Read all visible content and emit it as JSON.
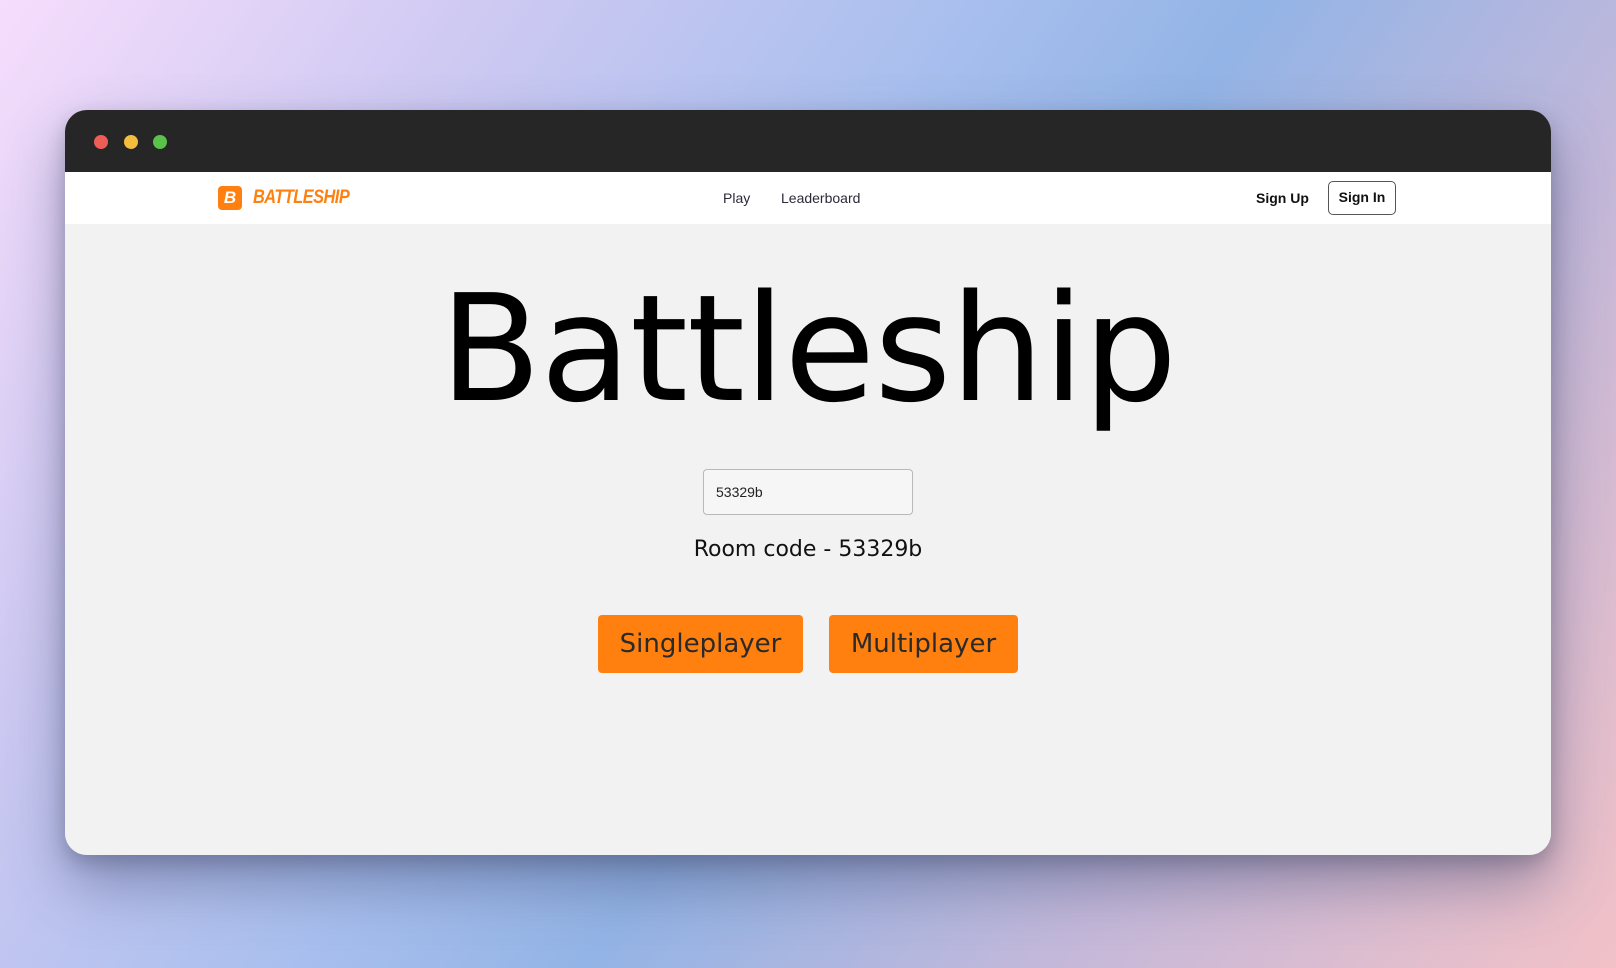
{
  "colors": {
    "accent": "#ff7f0f",
    "titlebar": "#262626",
    "content_background": "#f2f2f2"
  },
  "window": {
    "controls": [
      "close",
      "minimize",
      "maximize"
    ]
  },
  "navbar": {
    "brand_mark": "B",
    "brand_text": "BATTLESHIP",
    "links": [
      "Play",
      "Leaderboard"
    ],
    "sign_up_label": "Sign Up",
    "sign_in_label": "Sign In"
  },
  "main": {
    "title": "Battleship",
    "room_input_value": "53329b",
    "room_code_text": "Room code - 53329b",
    "singleplayer_label": "Singleplayer",
    "multiplayer_label": "Multiplayer"
  }
}
